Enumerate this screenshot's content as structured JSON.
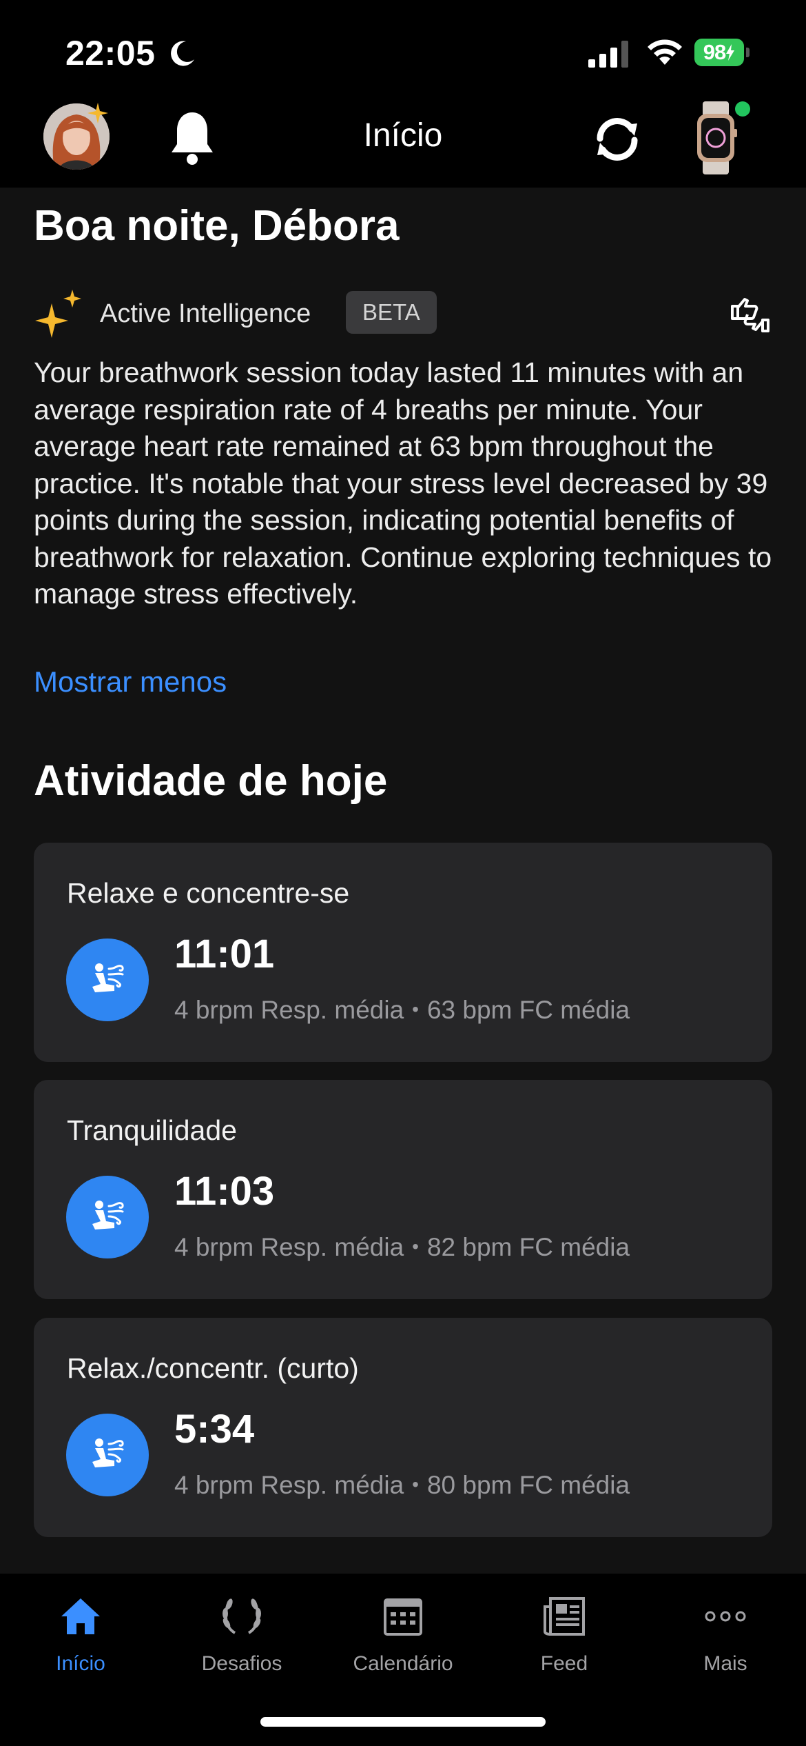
{
  "status_bar": {
    "time": "22:05",
    "battery_percent": "98",
    "icons": [
      "moon-icon",
      "signal-icon",
      "wifi-icon",
      "battery-charging-icon"
    ]
  },
  "header": {
    "title": "Início",
    "icons": [
      "avatar",
      "bell-icon",
      "sync-icon",
      "watch-icon"
    ]
  },
  "greeting": "Boa noite, Débora",
  "active_intelligence": {
    "label": "Active Intelligence",
    "badge": "BETA",
    "summary": "Your breathwork session today lasted 11 minutes with an average respiration rate of 4 breaths per minute. Your average heart rate remained at 63 bpm throughout the practice. It's notable that your stress level decreased by 39 points during the session, indicating potential benefits of breathwork for relaxation. Continue exploring techniques to manage stress effectively.",
    "toggle_label": "Mostrar menos"
  },
  "activity_section": {
    "title": "Atividade de hoje",
    "items": [
      {
        "title": "Relaxe e concentre-se",
        "duration": "11:01",
        "resp": "4 brpm Resp. média",
        "hr": "63 bpm FC média"
      },
      {
        "title": "Tranquilidade",
        "duration": "11:03",
        "resp": "4 brpm Resp. média",
        "hr": "82 bpm FC média"
      },
      {
        "title": "Relax./concentr. (curto)",
        "duration": "5:34",
        "resp": "4 brpm Resp. média",
        "hr": "80 bpm FC média"
      }
    ]
  },
  "tab_bar": {
    "tabs": [
      {
        "label": "Início",
        "icon": "home-icon",
        "active": true
      },
      {
        "label": "Desafios",
        "icon": "laurel-icon",
        "active": false
      },
      {
        "label": "Calendário",
        "icon": "calendar-icon",
        "active": false
      },
      {
        "label": "Feed",
        "icon": "newspaper-icon",
        "active": false
      },
      {
        "label": "Mais",
        "icon": "more-icon",
        "active": false
      }
    ]
  },
  "colors": {
    "accent": "#3b8fff",
    "activity_icon_bg": "#2f86f2",
    "battery": "#34c759",
    "spark": "#f5b82e",
    "card_bg": "#262628",
    "background": "#121212"
  }
}
